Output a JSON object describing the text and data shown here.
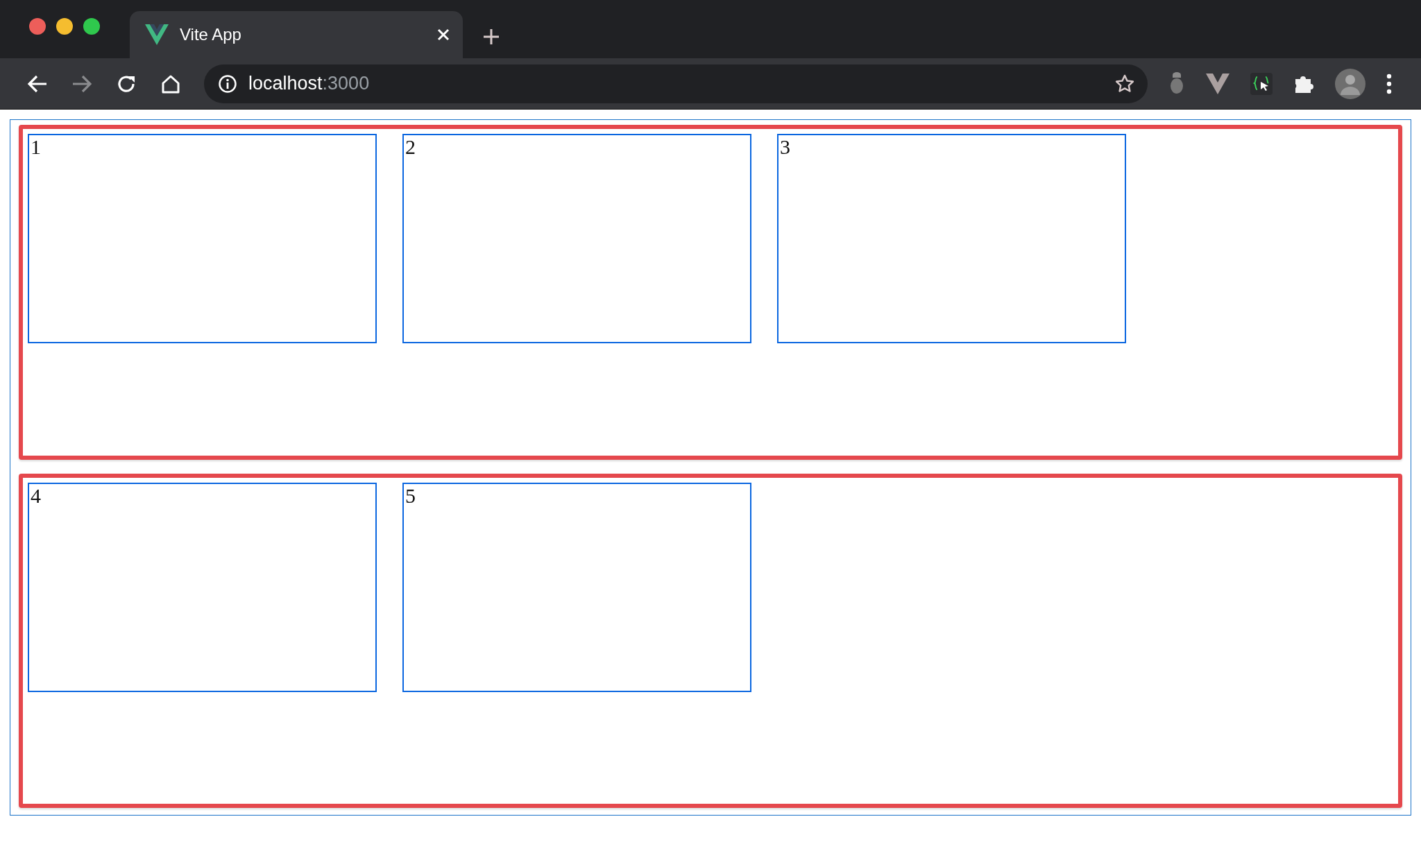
{
  "browser": {
    "tab": {
      "title": "Vite App"
    },
    "address": {
      "host": "localhost",
      "port": ":3000"
    }
  },
  "groups": [
    {
      "items": [
        "1",
        "2",
        "3"
      ]
    },
    {
      "items": [
        "4",
        "5"
      ]
    }
  ]
}
